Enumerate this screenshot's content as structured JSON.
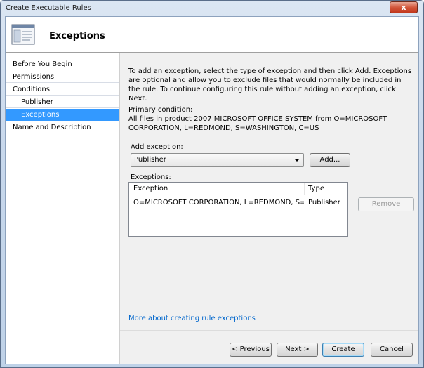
{
  "window": {
    "title": "Create Executable Rules",
    "close_glyph": "x"
  },
  "header": {
    "title": "Exceptions",
    "icon": "rules-wizard-icon"
  },
  "nav": {
    "items": [
      {
        "label": "Before You Begin"
      },
      {
        "label": "Permissions"
      },
      {
        "label": "Conditions"
      },
      {
        "label": "Publisher"
      },
      {
        "label": "Exceptions"
      },
      {
        "label": "Name and Description"
      }
    ]
  },
  "content": {
    "description": "To add an exception, select the type of exception and then click Add. Exceptions are optional and allow you to exclude files that would normally be included in the rule. To continue configuring this rule without adding an exception, click Next.",
    "primary_condition_label": "Primary condition:",
    "primary_condition_value": "All files in product 2007 MICROSOFT OFFICE SYSTEM from O=MICROSOFT CORPORATION, L=REDMOND, S=WASHINGTON, C=US",
    "add_exception_label": "Add exception:",
    "add_exception_value": "Publisher",
    "add_button": "Add...",
    "exceptions_label": "Exceptions:",
    "remove_button": "Remove",
    "table": {
      "columns": [
        "Exception",
        "Type"
      ],
      "rows": [
        {
          "exception": "O=MICROSOFT CORPORATION, L=REDMOND, S=WA...",
          "type": "Publisher"
        }
      ]
    },
    "more_link": "More about creating rule exceptions"
  },
  "footer": {
    "previous": "< Previous",
    "next": "Next >",
    "create": "Create",
    "cancel": "Cancel"
  },
  "colors": {
    "selection": "#3399ff",
    "link": "#0066cc"
  }
}
